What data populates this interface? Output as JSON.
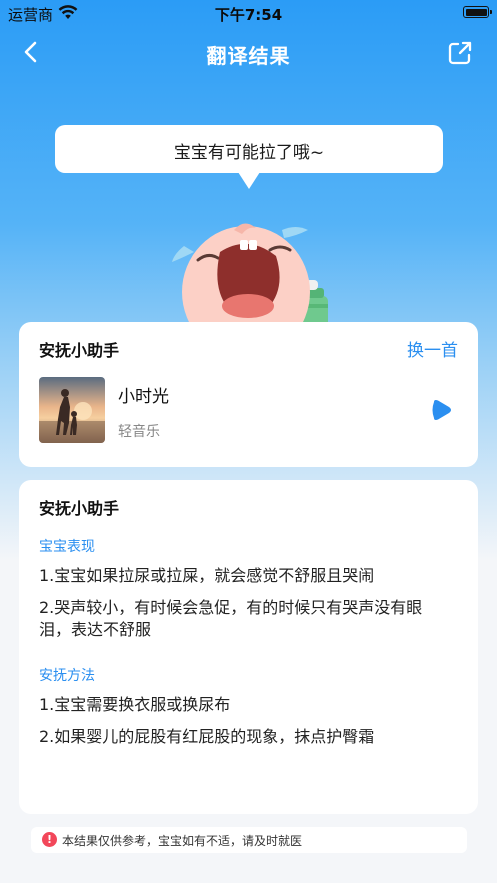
{
  "status_bar": {
    "carrier": "运营商",
    "time": "下午7:54"
  },
  "nav": {
    "title": "翻译结果",
    "back_icon": "chevron-left-icon",
    "share_icon": "share-icon"
  },
  "bubble": {
    "text": "宝宝有可能拉了哦~"
  },
  "soothe_card": {
    "title": "安抚小助手",
    "switch_label": "换一首",
    "song": {
      "title": "小时光",
      "subtitle": "轻音乐"
    },
    "play_icon": "play-icon"
  },
  "advice_card": {
    "title": "安抚小助手",
    "performance": {
      "label": "宝宝表现",
      "items": [
        "1.宝宝如果拉尿或拉屎，就会感觉不舒服且哭闹",
        "2.哭声较小，有时候会急促，有的时候只有哭声没有眼泪，表达不舒服"
      ]
    },
    "methods": {
      "label": "安抚方法",
      "items": [
        "1.宝宝需要换衣服或换尿布",
        "2.如果婴儿的屁股有红屁股的现象，抹点护臀霜"
      ]
    }
  },
  "notice": {
    "text": "本结果仅供参考，宝宝如有不适，请及时就医"
  },
  "colors": {
    "accent": "#2b8ff0",
    "header_blue": "#2b9cf6",
    "warning_red": "#f2475a"
  }
}
